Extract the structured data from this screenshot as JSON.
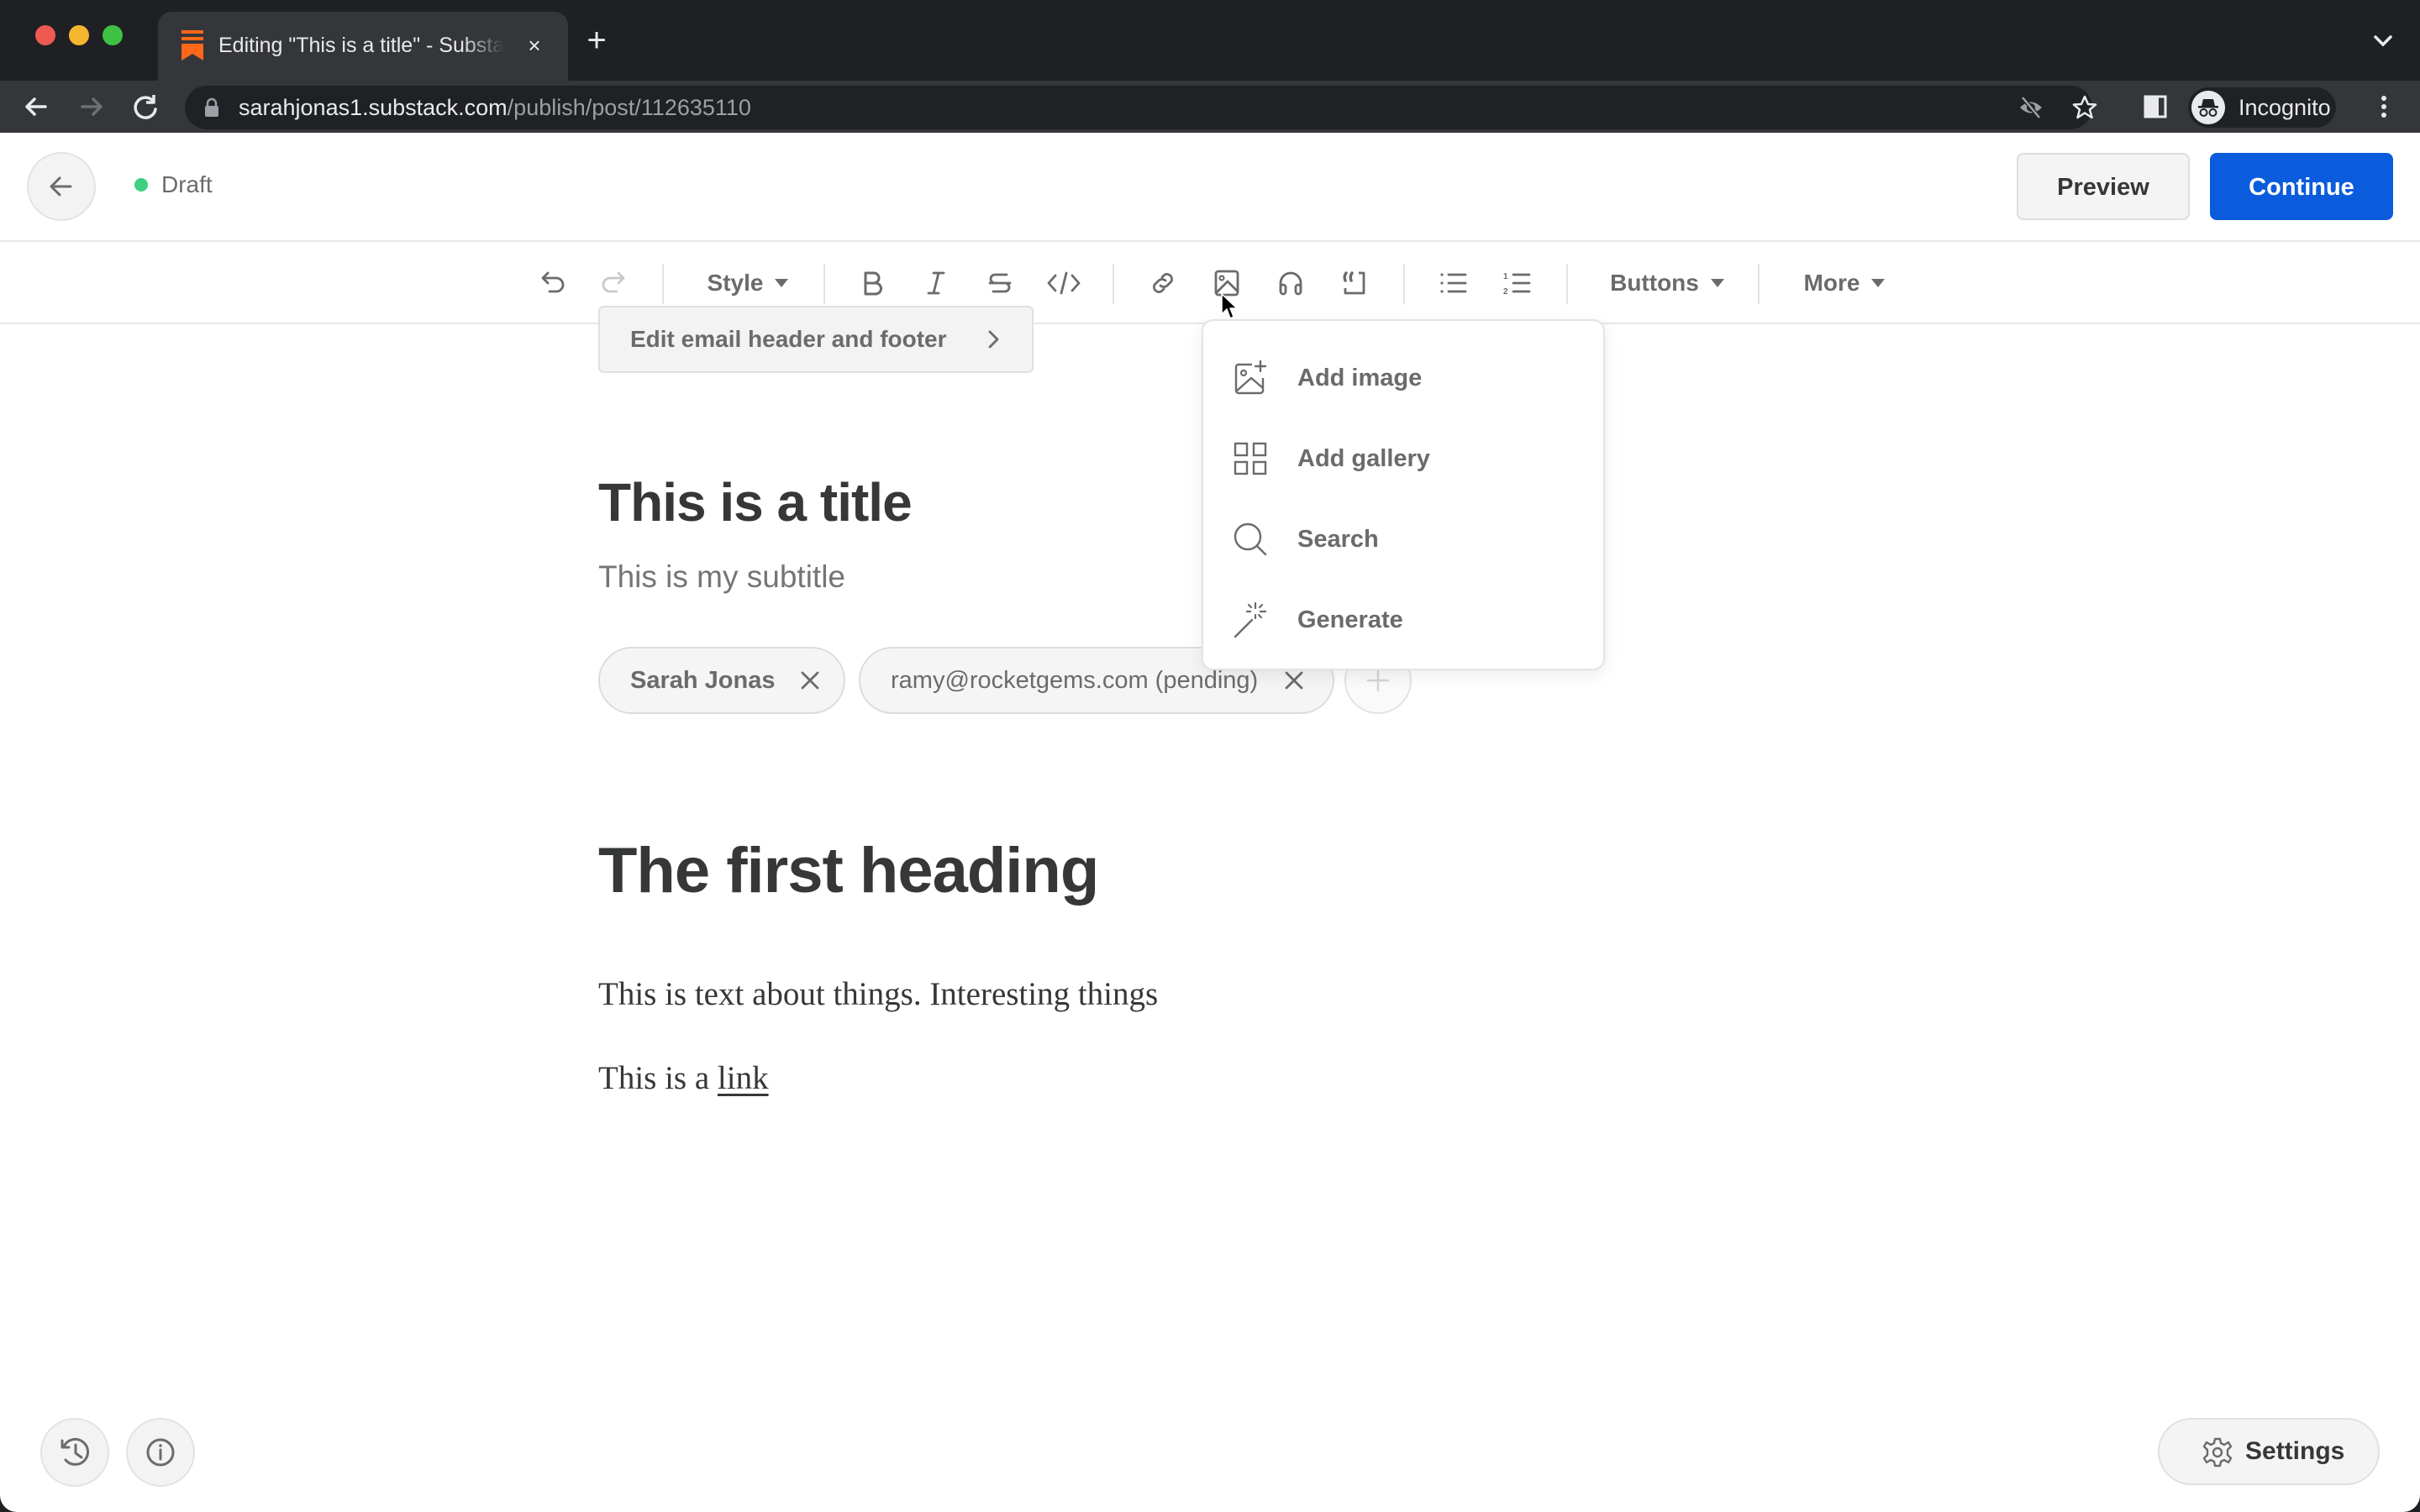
{
  "browser": {
    "tab_title": "Editing \"This is a title\" - Substack",
    "tab_close": "×",
    "new_tab": "+",
    "url_host": "sarahjonas1.substack.com",
    "url_path": "/publish/post/112635110",
    "profile_label": "Incognito"
  },
  "header": {
    "status": "Draft",
    "status_color": "#3ecf83",
    "preview_label": "Preview",
    "continue_label": "Continue",
    "accent_color": "#0b5cdc"
  },
  "toolbar": {
    "style_label": "Style",
    "buttons_label": "Buttons",
    "more_label": "More"
  },
  "image_menu": {
    "items": [
      {
        "label": "Add image",
        "icon": "add-image-icon"
      },
      {
        "label": "Add gallery",
        "icon": "gallery-icon"
      },
      {
        "label": "Search",
        "icon": "search-icon"
      },
      {
        "label": "Generate",
        "icon": "magic-wand-icon"
      }
    ]
  },
  "editor": {
    "email_header_footer_label": "Edit email header and footer",
    "title": "This is a title",
    "subtitle": "This is my subtitle",
    "authors": [
      {
        "label": "Sarah Jonas"
      },
      {
        "label": "ramy@rocketgems.com (pending)"
      }
    ],
    "heading": "The first heading",
    "paragraph1": "This is text about things. Interesting things",
    "paragraph2_prefix": "This is a ",
    "paragraph2_link": "link"
  },
  "footer": {
    "settings_label": "Settings"
  }
}
